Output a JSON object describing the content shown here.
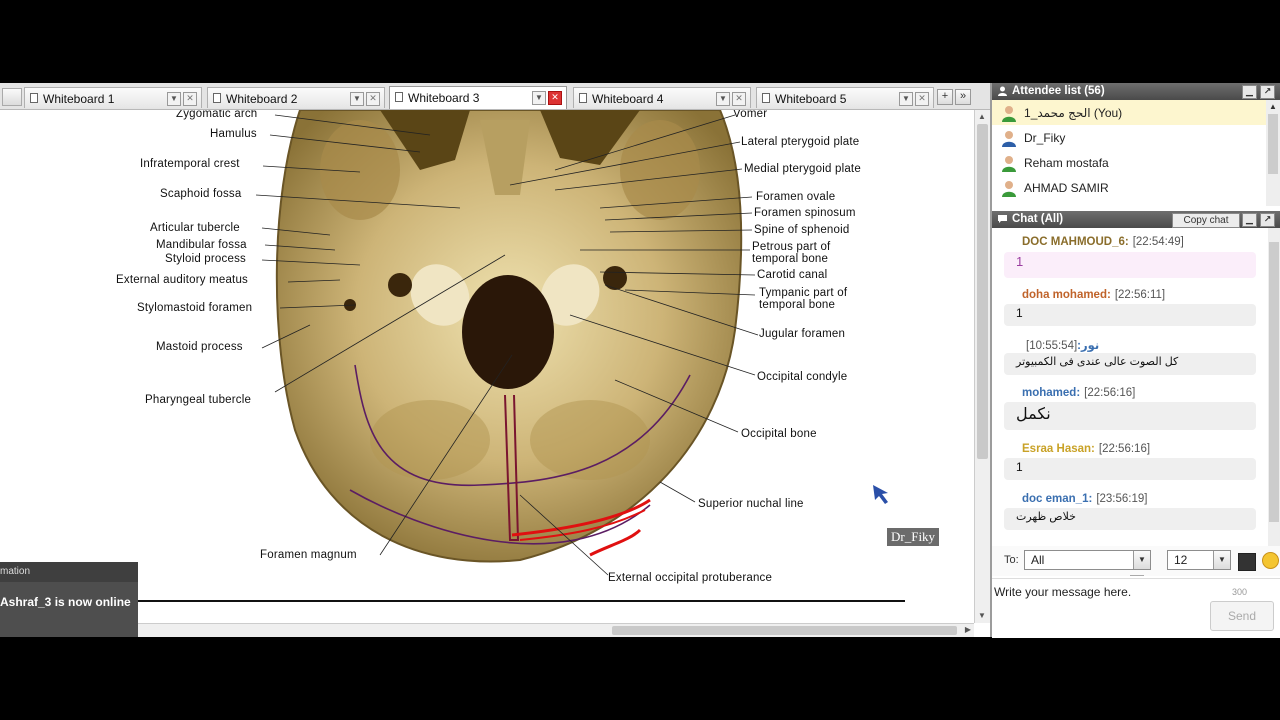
{
  "tabs": [
    {
      "label": "Whiteboard 1",
      "active": false
    },
    {
      "label": "Whiteboard 2",
      "active": false
    },
    {
      "label": "Whiteboard 3",
      "active": true
    },
    {
      "label": "Whiteboard 4",
      "active": false
    },
    {
      "label": "Whiteboard 5",
      "active": false
    }
  ],
  "tab_buttons": {
    "add": "+",
    "more": "»"
  },
  "diagram": {
    "left_labels": [
      "Zygomatic arch",
      "Hamulus",
      "Infratemporal crest",
      "Scaphoid fossa",
      "Articular tubercle",
      "Mandibular fossa",
      "Styloid process",
      "External auditory meatus",
      "Stylomastoid foramen",
      "Mastoid process",
      "Pharyngeal tubercle",
      "Foramen magnum"
    ],
    "right_labels": [
      "Vomer",
      "Lateral pterygoid plate",
      "Medial pterygoid plate",
      "Foramen ovale",
      "Foramen spinosum",
      "Spine of sphenoid",
      "Petrous part of",
      "temporal bone",
      "Carotid canal",
      "Tympanic part of",
      "temporal bone",
      "Jugular foramen",
      "Occipital condyle",
      "Occipital bone",
      "Superior nuchal line",
      "External occipital protuberance"
    ]
  },
  "cursor_label": "Dr_Fiky",
  "notification": {
    "header": "mation",
    "message": "Ashraf_3 is now online"
  },
  "attendees": {
    "title": "Attendee list (56)",
    "list": [
      "الحج محمد_1 (You)",
      "Dr_Fiky",
      "Reham mostafa",
      "AHMAD SAMIR"
    ]
  },
  "chat": {
    "title": "Chat (All)",
    "copy_label": "Copy chat",
    "messages": [
      {
        "name": "DOC MAHMOUD_6:",
        "time": "[22:54:49]",
        "text": "1",
        "color": "#8a6d2b"
      },
      {
        "name": "doha mohamed:",
        "time": "[22:56:11]",
        "text": "1",
        "color": "#c0632a"
      },
      {
        "name": "نور:",
        "time": "[10:55:54]",
        "text": "كل الصوت عالى عندى فى الكمبيوتر",
        "color": "#3a6fb0"
      },
      {
        "name": "mohamed:",
        "time": "[22:56:16]",
        "text": "نكمل",
        "color": "#3a6fb0"
      },
      {
        "name": "Esraa Hasan:",
        "time": "[22:56:16]",
        "text": "1",
        "color": "#c9a227"
      },
      {
        "name": "doc eman_1:",
        "time": "[23:56:19]",
        "text": "خلاص ظهرت",
        "color": "#3a6fb0"
      }
    ],
    "to_label": "To:",
    "to_value": "All",
    "font_size": "12",
    "input_text": "Write your message here.",
    "char_count": "300",
    "send_label": "Send"
  }
}
